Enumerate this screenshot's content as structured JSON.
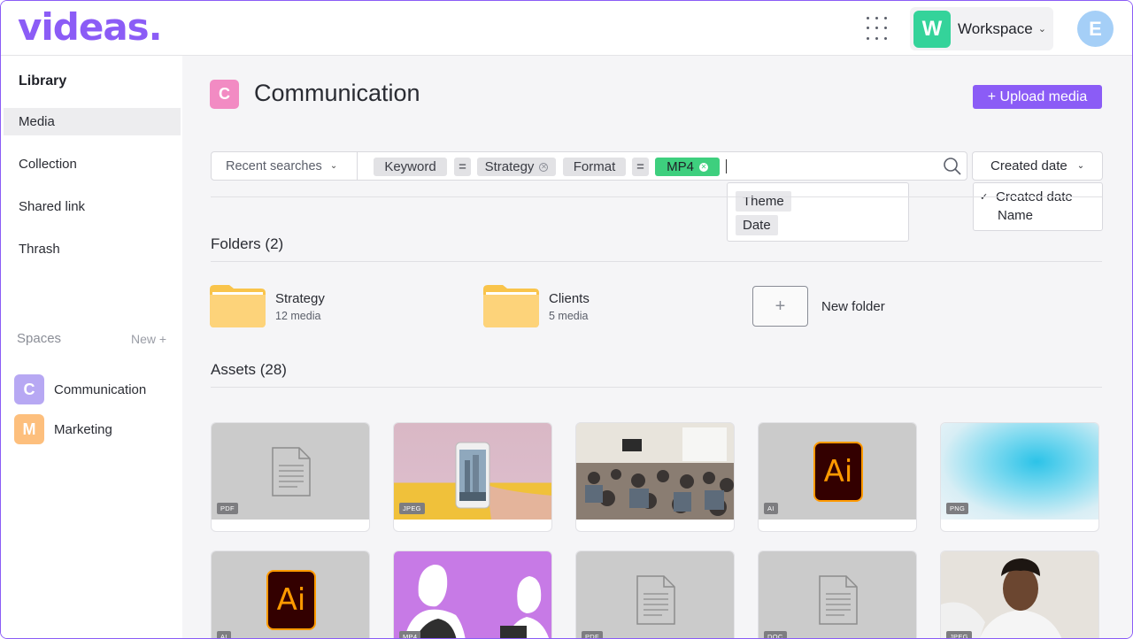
{
  "header": {
    "logo": "videas.",
    "workspace_initial": "W",
    "workspace_label": "Workspace",
    "avatar_initial": "E"
  },
  "sidebar": {
    "title": "Library",
    "items": [
      {
        "label": "Media",
        "active": true
      },
      {
        "label": "Collection"
      },
      {
        "label": "Shared link"
      },
      {
        "label": "Thrash"
      }
    ],
    "spaces_label": "Spaces",
    "new_label": "New +",
    "spaces": [
      {
        "initial": "C",
        "label": "Communication",
        "color": "#b7a8f3"
      },
      {
        "initial": "M",
        "label": "Marketing",
        "color": "#fdbf7d"
      }
    ]
  },
  "page": {
    "badge": "C",
    "title": "Communication",
    "upload_label": "+ Upload media"
  },
  "search": {
    "recent_label": "Recent searches",
    "chips": [
      "Keyword",
      "=",
      "Strategy",
      "Format",
      "=",
      "MP4"
    ],
    "suggestions": [
      "Theme",
      "Date"
    ]
  },
  "sort": {
    "selected": "Created date",
    "options": [
      "Created date",
      "Name"
    ]
  },
  "folders": {
    "heading": "Folders (2)",
    "items": [
      {
        "name": "Strategy",
        "count": "12 media"
      },
      {
        "name": "Clients",
        "count": "5 media"
      }
    ],
    "new_label": "New folder"
  },
  "assets": {
    "heading": "Assets (28)",
    "items": [
      {
        "type": "PDF"
      },
      {
        "type": "JPEG"
      },
      {
        "type": ""
      },
      {
        "type": "AI",
        "icon_text": "Ai"
      },
      {
        "type": "PNG"
      },
      {
        "type": "AI",
        "icon_text": "Ai"
      },
      {
        "type": "MP4"
      },
      {
        "type": "PDF"
      },
      {
        "type": "DOC"
      },
      {
        "type": "JPEG"
      }
    ]
  },
  "colors": {
    "brand": "#8b5cf6",
    "workspace": "#34d39a",
    "mp4_chip": "#3ecf7e",
    "page_badge": "#f28bc3",
    "avatar": "#a5cff7"
  }
}
